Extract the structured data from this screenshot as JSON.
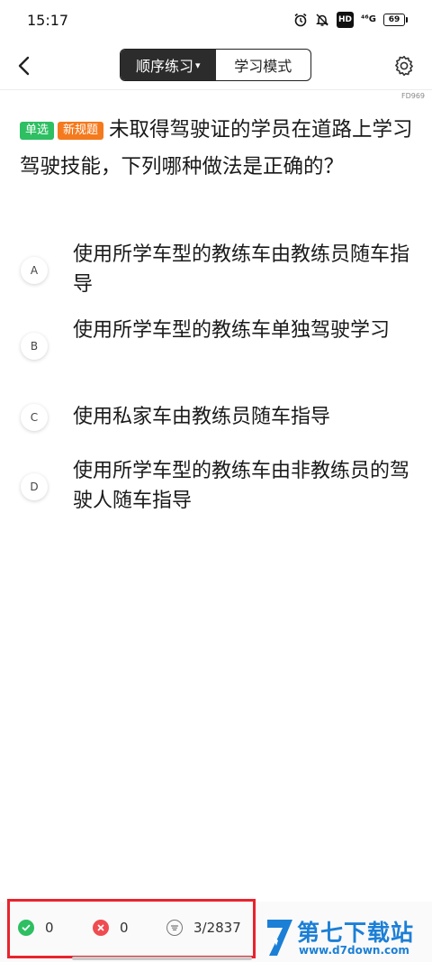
{
  "status_bar": {
    "time": "15:17",
    "network": "⁴⁶G",
    "hd": "HD",
    "battery": "69"
  },
  "nav": {
    "mode_tabs": [
      {
        "label": "顺序练习",
        "active": true
      },
      {
        "label": "学习模式",
        "active": false
      }
    ],
    "question_id": "FD969"
  },
  "question": {
    "tags": [
      "单选",
      "新规题"
    ],
    "text": "未取得驾驶证的学员在道路上学习驾驶技能，下列哪种做法是正确的？"
  },
  "options": [
    {
      "letter": "A",
      "text": "使用所学车型的教练车由教练员随车指导"
    },
    {
      "letter": "B",
      "text": "使用所学车型的教练车单独驾驶学习"
    },
    {
      "letter": "C",
      "text": "使用私家车由教练员随车指导"
    },
    {
      "letter": "D",
      "text": "使用所学车型的教练车由非教练员的驾驶人随车指导"
    }
  ],
  "bottom": {
    "correct_count": "0",
    "wrong_count": "0",
    "progress": "3/2837"
  },
  "watermark": {
    "name": "第七下载站",
    "url": "www.d7down.com"
  },
  "colors": {
    "correct": "#2dbf62",
    "wrong": "#ef4b51",
    "tag_orange": "#f47a1d",
    "highlight": "#e8232d",
    "watermark": "#1c7fd6"
  }
}
